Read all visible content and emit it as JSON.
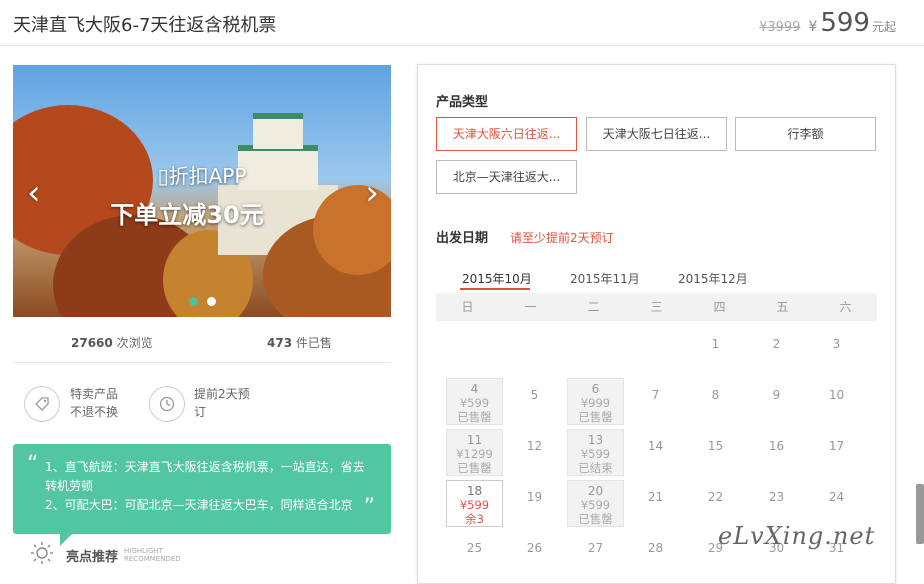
{
  "header": {
    "title": "天津直飞大阪6-7天往返含税机票",
    "old_price": "¥3999",
    "currency": "¥",
    "price": "599",
    "price_suffix": "元起"
  },
  "banner": {
    "app_text": "▯折扣APP",
    "main_text": "下单立减30元",
    "prev_glyph": "‹",
    "next_glyph": "›",
    "slides": 2,
    "active_slide": 1
  },
  "stats": {
    "views_count": "27660",
    "views_label": "次浏览",
    "sold_count": "473",
    "sold_label": "件已售"
  },
  "features": [
    {
      "icon": "tag-icon",
      "line1": "特卖产品",
      "line2": "不退不换"
    },
    {
      "icon": "clock-icon",
      "line1": "提前2天预",
      "line2": "订"
    }
  ],
  "promo": {
    "quote_open": "“",
    "quote_close": "”",
    "line1": "1、直飞航班：天津直飞大阪往返含税机票，一站直达，省去转机劳顿",
    "line2": "2、可配大巴：可配北京—天津往返大巴车，同样适合北京"
  },
  "highlight": {
    "icon": "sun-icon",
    "label": "亮点推荐",
    "en_line1": "HIGHLIGHT",
    "en_line2": "RECOMMENDED"
  },
  "booking": {
    "product_type_label": "产品类型",
    "options": [
      {
        "label": "天津大阪六日往返...",
        "selected": true
      },
      {
        "label": "天津大阪七日往返...",
        "selected": false
      },
      {
        "label": "行李额",
        "selected": false
      },
      {
        "label": "北京—天津往返大...",
        "selected": false
      }
    ],
    "date_label": "出发日期",
    "date_hint": "请至少提前2天预订",
    "months": [
      "2015年10月",
      "2015年11月",
      "2015年12月"
    ],
    "active_month": 0,
    "weekdays": [
      "日",
      "一",
      "二",
      "三",
      "四",
      "五",
      "六"
    ],
    "days": [
      {
        "d": "1",
        "status": "plain"
      },
      {
        "d": "2",
        "status": "plain"
      },
      {
        "d": "3",
        "status": "plain"
      },
      {
        "d": "4",
        "status": "soldout",
        "price": "¥599",
        "state": "已售罄"
      },
      {
        "d": "5",
        "status": "plain"
      },
      {
        "d": "6",
        "status": "soldout",
        "price": "¥999",
        "state": "已售罄"
      },
      {
        "d": "7",
        "status": "plain"
      },
      {
        "d": "8",
        "status": "plain"
      },
      {
        "d": "9",
        "status": "plain"
      },
      {
        "d": "10",
        "status": "plain"
      },
      {
        "d": "11",
        "status": "soldout",
        "price": "¥1299",
        "state": "已售罄"
      },
      {
        "d": "12",
        "status": "plain"
      },
      {
        "d": "13",
        "status": "soldout",
        "price": "¥599",
        "state": "已结束"
      },
      {
        "d": "14",
        "status": "plain"
      },
      {
        "d": "15",
        "status": "plain"
      },
      {
        "d": "16",
        "status": "plain"
      },
      {
        "d": "17",
        "status": "plain"
      },
      {
        "d": "18",
        "status": "avail",
        "price": "¥599",
        "state": "余3"
      },
      {
        "d": "19",
        "status": "plain"
      },
      {
        "d": "20",
        "status": "soldout",
        "price": "¥599",
        "state": "已售罄"
      },
      {
        "d": "21",
        "status": "plain"
      },
      {
        "d": "22",
        "status": "plain"
      },
      {
        "d": "23",
        "status": "plain"
      },
      {
        "d": "24",
        "status": "plain"
      },
      {
        "d": "25",
        "status": "plain"
      },
      {
        "d": "26",
        "status": "plain"
      },
      {
        "d": "27",
        "status": "plain"
      },
      {
        "d": "28",
        "status": "plain"
      },
      {
        "d": "29",
        "status": "plain"
      },
      {
        "d": "30",
        "status": "plain"
      },
      {
        "d": "31",
        "status": "plain"
      }
    ],
    "first_weekday": 4
  },
  "watermark": "eLvXing.net"
}
